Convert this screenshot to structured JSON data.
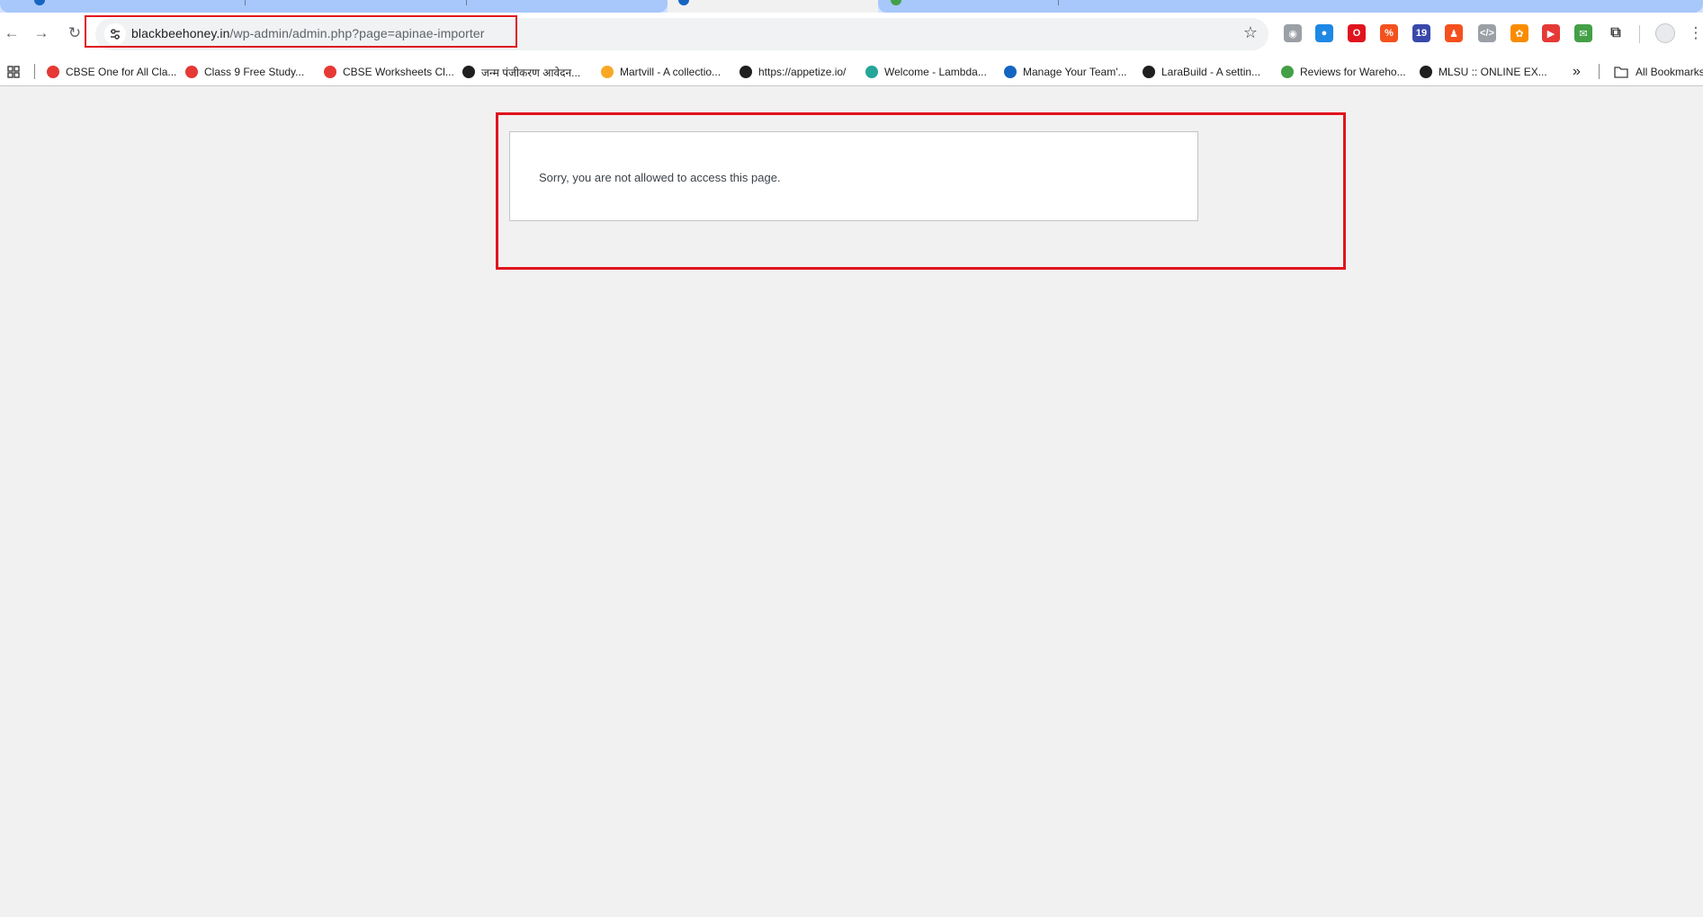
{
  "browser": {
    "url_host": "blackbeehoney.in",
    "url_path": "/wp-admin/admin.php?page=apinae-importer",
    "extensions": [
      {
        "name": "camera-extension-icon",
        "color": "#9aa0a6",
        "glyph": "◉"
      },
      {
        "name": "color-picker-extension-icon",
        "color": "#1e88e5",
        "glyph": "●"
      },
      {
        "name": "opera-extension-icon",
        "color": "#e0141e",
        "glyph": "O"
      },
      {
        "name": "percent-extension-icon",
        "color": "#f4511e",
        "glyph": "%"
      },
      {
        "name": "graduation-cap-extension-icon",
        "color": "#3949ab",
        "glyph": "19"
      },
      {
        "name": "figure-extension-icon",
        "color": "#f4511e",
        "glyph": "♟"
      },
      {
        "name": "code-extension-icon",
        "color": "#9aa0a6",
        "glyph": "</>"
      },
      {
        "name": "gear-extension-icon",
        "color": "#fb8c00",
        "glyph": "✿"
      },
      {
        "name": "play-extension-icon",
        "color": "#e53935",
        "glyph": "▶"
      },
      {
        "name": "mail-extension-icon",
        "color": "#43a047",
        "glyph": "✉"
      },
      {
        "name": "puzzle-extensions-icon",
        "color": "#3c3c3c",
        "glyph": "⧉"
      }
    ]
  },
  "bookmarks": {
    "items": [
      {
        "label": "CBSE One for All Cla...",
        "color": "#e53935"
      },
      {
        "label": "Class 9 Free Study...",
        "color": "#e53935"
      },
      {
        "label": "CBSE Worksheets Cl...",
        "color": "#e53935"
      },
      {
        "label": "जन्म पंजीकरण आवेदन...",
        "color": "#1f1f1f"
      },
      {
        "label": "Martvill - A collectio...",
        "color": "#f9a825"
      },
      {
        "label": "https://appetize.io/",
        "color": "#1f1f1f"
      },
      {
        "label": "Welcome - Lambda...",
        "color": "#26a69a"
      },
      {
        "label": "Manage Your Team'...",
        "color": "#1565c0"
      },
      {
        "label": "LaraBuild - A settin...",
        "color": "#1f1f1f"
      },
      {
        "label": "Reviews for Wareho...",
        "color": "#43a047"
      },
      {
        "label": "MLSU :: ONLINE EX...",
        "color": "#1f1f1f"
      }
    ],
    "overflow": "»",
    "all_bookmarks": "All Bookmarks"
  },
  "page": {
    "message": "Sorry, you are not allowed to access this page."
  },
  "colors": {
    "annotation": "#e0141e",
    "page_background": "#f1f1f1"
  }
}
